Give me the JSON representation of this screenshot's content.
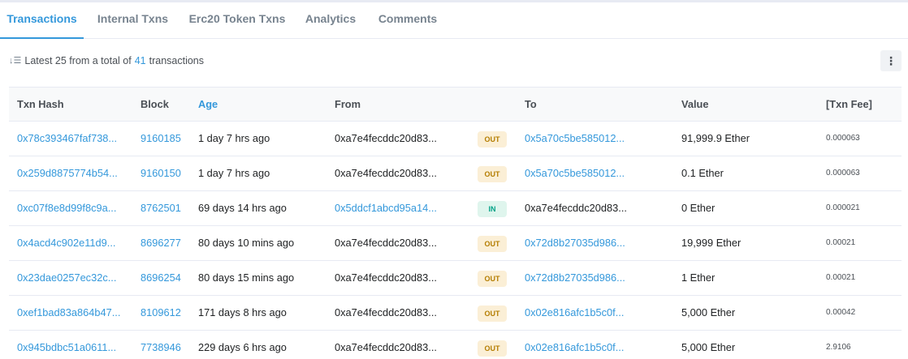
{
  "tabs": [
    "Transactions",
    "Internal Txns",
    "Erc20 Token Txns",
    "Analytics",
    "Comments"
  ],
  "summary": {
    "prefix": "Latest 25 from a total of",
    "count": "41",
    "suffix": "transactions"
  },
  "more_label": "⋮",
  "columns": [
    "Txn Hash",
    "Block",
    "Age",
    "From",
    "",
    "To",
    "Value",
    "[Txn Fee]"
  ],
  "rows": [
    {
      "hash": "0x78c393467faf738...",
      "block": "9160185",
      "age": "1 day 7 hrs ago",
      "from": "0xa7e4fecddc20d83...",
      "dir": "OUT",
      "to": "0x5a70c5be585012...",
      "value": "91,999.9 Ether",
      "fee": "0.000063"
    },
    {
      "hash": "0x259d8875774b54...",
      "block": "9160150",
      "age": "1 day 7 hrs ago",
      "from": "0xa7e4fecddc20d83...",
      "dir": "OUT",
      "to": "0x5a70c5be585012...",
      "value": "0.1 Ether",
      "fee": "0.000063"
    },
    {
      "hash": "0xc07f8e8d99f8c9a...",
      "block": "8762501",
      "age": "69 days 14 hrs ago",
      "from": "0x5ddcf1abcd95a14...",
      "dir": "IN",
      "to": "0xa7e4fecddc20d83...",
      "value": "0 Ether",
      "fee": "0.000021"
    },
    {
      "hash": "0x4acd4c902e11d9...",
      "block": "8696277",
      "age": "80 days 10 mins ago",
      "from": "0xa7e4fecddc20d83...",
      "dir": "OUT",
      "to": "0x72d8b27035d986...",
      "value": "19,999 Ether",
      "fee": "0.00021"
    },
    {
      "hash": "0x23dae0257ec32c...",
      "block": "8696254",
      "age": "80 days 15 mins ago",
      "from": "0xa7e4fecddc20d83...",
      "dir": "OUT",
      "to": "0x72d8b27035d986...",
      "value": "1 Ether",
      "fee": "0.00021"
    },
    {
      "hash": "0xef1bad83a864b47...",
      "block": "8109612",
      "age": "171 days 8 hrs ago",
      "from": "0xa7e4fecddc20d83...",
      "dir": "OUT",
      "to": "0x02e816afc1b5c0f...",
      "value": "5,000 Ether",
      "fee": "0.00042"
    },
    {
      "hash": "0x945bdbc51a0611...",
      "block": "7738946",
      "age": "229 days 6 hrs ago",
      "from": "0xa7e4fecddc20d83...",
      "dir": "OUT",
      "to": "0x02e816afc1b5c0f...",
      "value": "5,000 Ether",
      "fee": "2.9106"
    }
  ],
  "colors": {
    "accent": "#3498db",
    "out_badge": "#fbefd6",
    "in_badge": "#dff5ed"
  }
}
